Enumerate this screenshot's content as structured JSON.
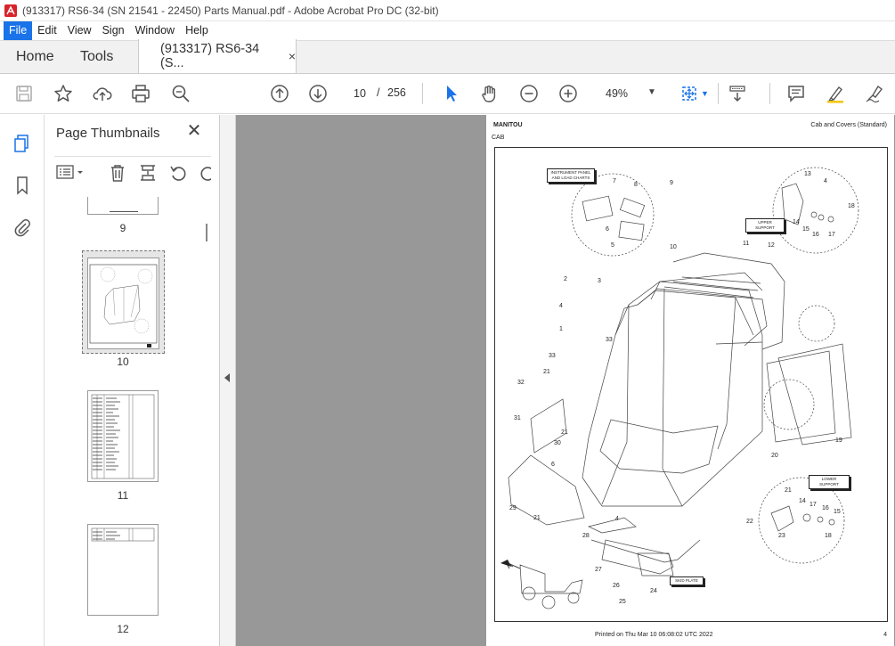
{
  "window": {
    "title": "(913317) RS6-34 (SN 21541 - 22450) Parts Manual.pdf - Adobe Acrobat Pro DC (32-bit)"
  },
  "menu": [
    "File",
    "Edit",
    "View",
    "Sign",
    "Window",
    "Help"
  ],
  "tabs": {
    "home": "Home",
    "tools": "Tools",
    "doc": "(913317) RS6-34 (S...",
    "doc_close": "×"
  },
  "toolbar": {
    "current_page": "10",
    "page_sep": "/",
    "total_pages": "256",
    "zoom": "49%"
  },
  "thumbnails": {
    "title": "Page Thumbnails",
    "close": "✕",
    "pages": [
      "9",
      "10",
      "11",
      "12"
    ],
    "selected": "10"
  },
  "pdf": {
    "header_left": "MANITOU",
    "header_sub": "CAB",
    "header_right": "Cab and Covers (Standard)",
    "footer": "Printed on  Thu Mar 10 06:08:02 UTC 2022",
    "page_number": "4",
    "labels": {
      "instrument_panel_1": "INSTRUMENT PANEL",
      "instrument_panel_2": "AND LOAD CHARTS",
      "upper_support": "UPPER SUPPORT",
      "lower_support": "LOWER SUPPORT",
      "skid_plate": "SKID PLATE"
    },
    "callouts": [
      "7",
      "8",
      "9",
      "6",
      "5",
      "13",
      "4",
      "18",
      "14",
      "15",
      "16",
      "17",
      "10",
      "11",
      "12",
      "2",
      "3",
      "4",
      "1",
      "33",
      "33",
      "21",
      "32",
      "31",
      "21",
      "30",
      "6",
      "19",
      "20",
      "21",
      "14",
      "17",
      "16",
      "15",
      "22",
      "23",
      "18",
      "29",
      "21",
      "4",
      "28",
      "27",
      "26",
      "24",
      "25"
    ]
  },
  "colors": {
    "accent": "#1a73e8",
    "icon_blue": "#1a73e8",
    "adobe_red": "#d8232a",
    "doc_bg": "#989898"
  }
}
